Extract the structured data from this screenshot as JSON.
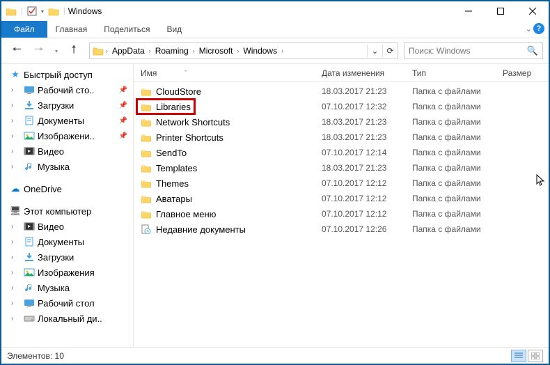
{
  "window": {
    "title": "Windows"
  },
  "ribbon": {
    "file": "Файл",
    "tabs": [
      "Главная",
      "Поделиться",
      "Вид"
    ]
  },
  "breadcrumb": {
    "segments": [
      "AppData",
      "Roaming",
      "Microsoft",
      "Windows"
    ]
  },
  "search": {
    "placeholder": "Поиск: Windows"
  },
  "sidebar": {
    "quick_access": {
      "label": "Быстрый доступ",
      "items": [
        {
          "label": "Рабочий сто..",
          "pinned": true,
          "icon": "desktop"
        },
        {
          "label": "Загрузки",
          "pinned": true,
          "icon": "downloads"
        },
        {
          "label": "Документы",
          "pinned": true,
          "icon": "documents"
        },
        {
          "label": "Изображени..",
          "pinned": true,
          "icon": "pictures"
        },
        {
          "label": "Видео",
          "pinned": false,
          "icon": "videos"
        },
        {
          "label": "Музыка",
          "pinned": false,
          "icon": "music"
        }
      ]
    },
    "onedrive": {
      "label": "OneDrive"
    },
    "this_pc": {
      "label": "Этот компьютер",
      "items": [
        {
          "label": "Видео",
          "icon": "videos"
        },
        {
          "label": "Документы",
          "icon": "documents"
        },
        {
          "label": "Загрузки",
          "icon": "downloads"
        },
        {
          "label": "Изображения",
          "icon": "pictures"
        },
        {
          "label": "Музыка",
          "icon": "music"
        },
        {
          "label": "Рабочий стол",
          "icon": "desktop"
        },
        {
          "label": "Локальный ди..",
          "icon": "disk"
        }
      ]
    }
  },
  "columns": {
    "name": "Имя",
    "date": "Дата изменения",
    "type": "Тип",
    "size": "Размер"
  },
  "files": [
    {
      "name": "CloudStore",
      "date": "18.03.2017 21:23",
      "type": "Папка с файлами",
      "icon": "folder",
      "highlight": false
    },
    {
      "name": "Libraries",
      "date": "07.10.2017 12:32",
      "type": "Папка с файлами",
      "icon": "folder",
      "highlight": true
    },
    {
      "name": "Network Shortcuts",
      "date": "18.03.2017 21:23",
      "type": "Папка с файлами",
      "icon": "folder",
      "highlight": false
    },
    {
      "name": "Printer Shortcuts",
      "date": "18.03.2017 21:23",
      "type": "Папка с файлами",
      "icon": "folder",
      "highlight": false
    },
    {
      "name": "SendTo",
      "date": "07.10.2017 12:14",
      "type": "Папка с файлами",
      "icon": "folder",
      "highlight": false
    },
    {
      "name": "Templates",
      "date": "18.03.2017 21:23",
      "type": "Папка с файлами",
      "icon": "folder",
      "highlight": false
    },
    {
      "name": "Themes",
      "date": "07.10.2017 12:12",
      "type": "Папка с файлами",
      "icon": "folder",
      "highlight": false
    },
    {
      "name": "Аватары",
      "date": "07.10.2017 12:12",
      "type": "Папка с файлами",
      "icon": "folder",
      "highlight": false
    },
    {
      "name": "Главное меню",
      "date": "07.10.2017 12:12",
      "type": "Папка с файлами",
      "icon": "folder",
      "highlight": false
    },
    {
      "name": "Недавние документы",
      "date": "07.10.2017 12:26",
      "type": "Папка с файлами",
      "icon": "recent",
      "highlight": false
    }
  ],
  "status": {
    "text": "Элементов: 10"
  }
}
